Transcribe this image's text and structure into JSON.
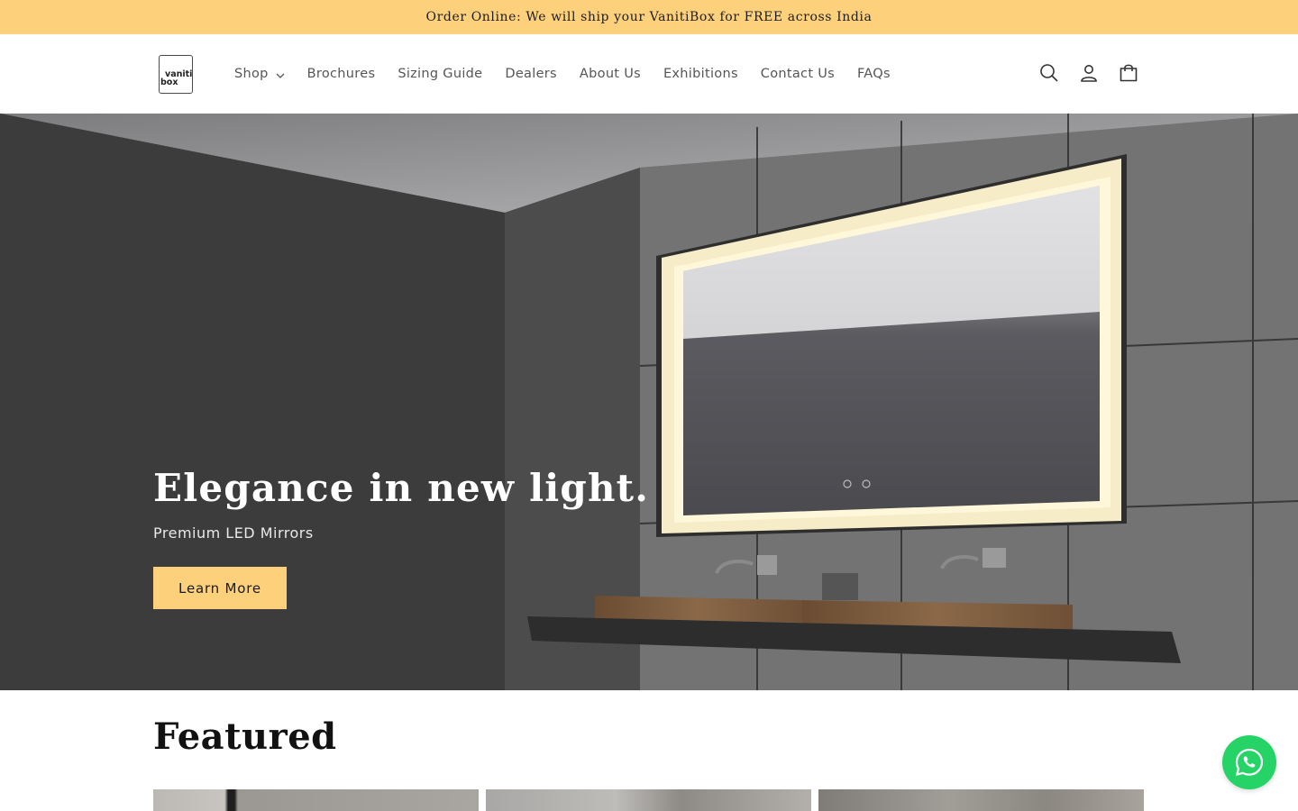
{
  "announcement": {
    "text": "Order Online: We will ship your VanitiBox for FREE across India"
  },
  "header": {
    "logo": {
      "line1": "vaniti",
      "line2": "box"
    },
    "nav": [
      {
        "label": "Shop",
        "has_dropdown": true
      },
      {
        "label": "Brochures"
      },
      {
        "label": "Sizing Guide"
      },
      {
        "label": "Dealers"
      },
      {
        "label": "About Us"
      },
      {
        "label": "Exhibitions"
      },
      {
        "label": "Contact Us"
      },
      {
        "label": "FAQs"
      }
    ],
    "icons": [
      "search-icon",
      "account-icon",
      "cart-icon"
    ]
  },
  "hero": {
    "title": "Elegance in new light.",
    "subtitle": "Premium LED Mirrors",
    "button_label": "Learn More"
  },
  "featured": {
    "title": "Featured",
    "card_count": 3
  },
  "colors": {
    "accent": "#fdd07c",
    "whatsapp": "#25d366",
    "text": "#121212"
  }
}
